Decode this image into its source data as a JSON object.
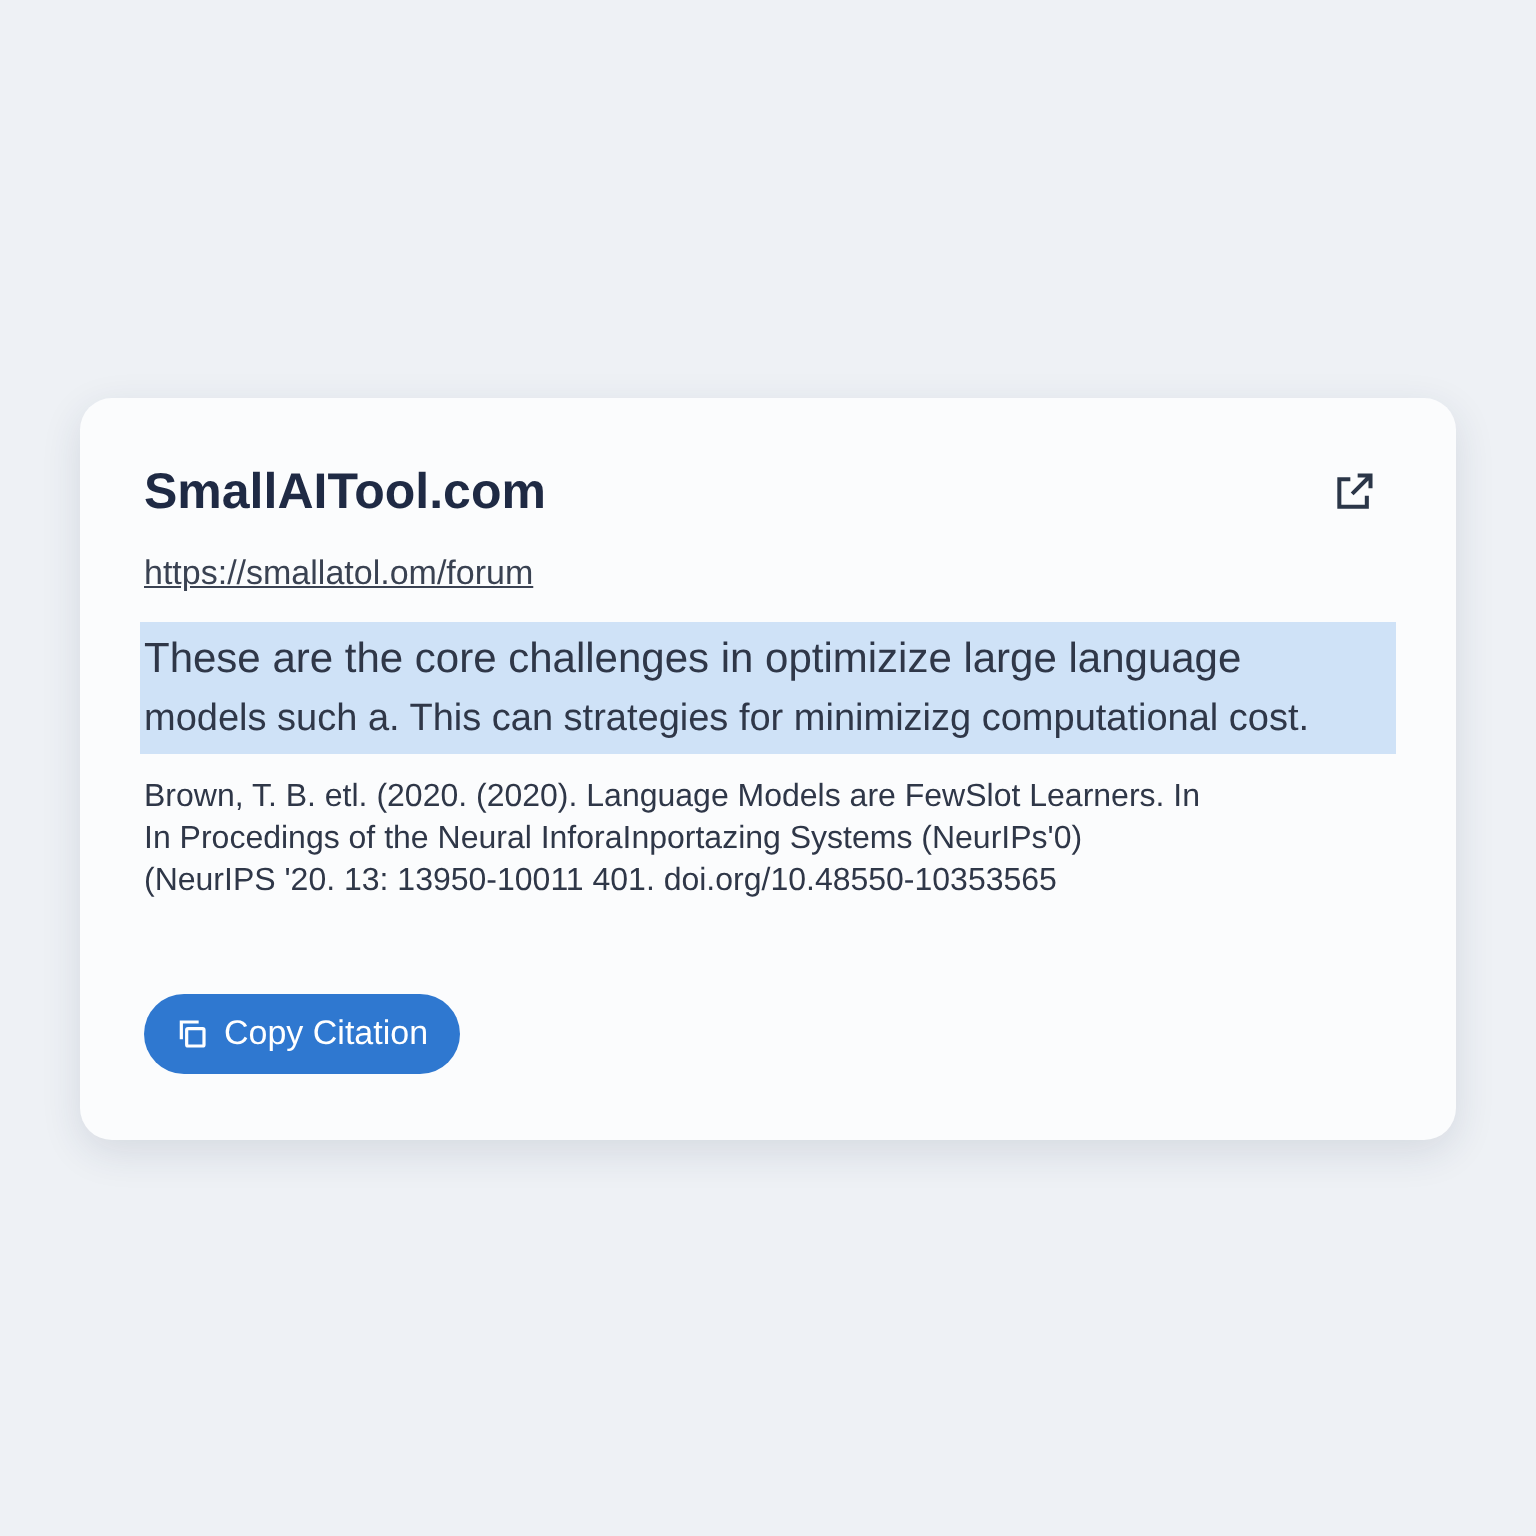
{
  "card": {
    "title": "SmallAITool.com",
    "url": "https://smallatol.om/forum",
    "excerpt": {
      "highlighted": true,
      "lines": [
        "These are the core challenges in optimizize large language",
        "models such  a. This can strategies for minimizizg  computational cost."
      ]
    },
    "citation": [
      "Brown, T. B. etl. (2020. (2020). Language Models are FewSlot Learners. In",
      "In Procedings of the Neural InforaInportazing Systems (NeurIPs'0)",
      "(NeurIPS '20. 13: 13950-10011 401. doi.org/10.48550-10353565"
    ],
    "button": {
      "label": "Copy Citation"
    }
  }
}
